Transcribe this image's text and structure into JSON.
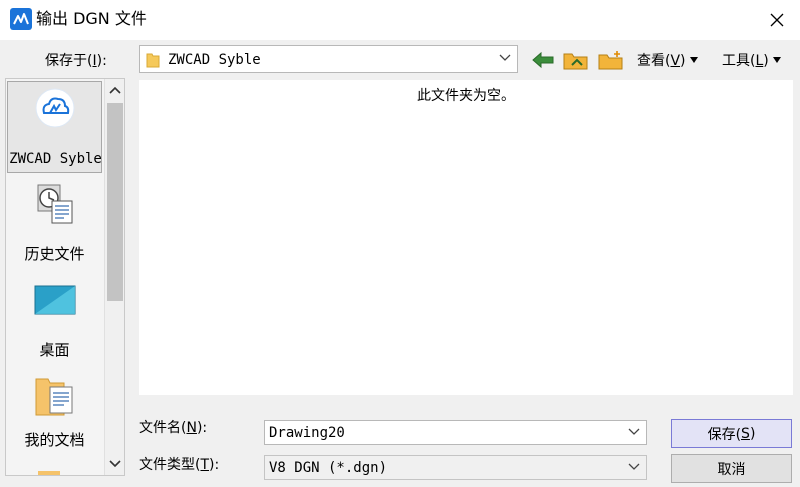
{
  "window": {
    "title": "输出 DGN 文件"
  },
  "toolbar": {
    "save_in_label_prefix": "保存于(",
    "save_in_label_key": "I",
    "save_in_label_suffix": "):",
    "path": "ZWCAD Syble",
    "view_menu_prefix": "查看(",
    "view_menu_key": "V",
    "view_menu_suffix": ")",
    "tools_menu_prefix": "工具(",
    "tools_menu_key": "L",
    "tools_menu_suffix": ")"
  },
  "places": [
    {
      "label": "ZWCAD Syble",
      "icon": "cloud-drive-icon"
    },
    {
      "label": "历史文件",
      "icon": "history-icon"
    },
    {
      "label": "桌面",
      "icon": "desktop-icon"
    },
    {
      "label": "我的文档",
      "icon": "documents-icon"
    }
  ],
  "filelist": {
    "empty_message": "此文件夹为空。"
  },
  "filename": {
    "label_prefix": "文件名(",
    "label_key": "N",
    "label_suffix": "):",
    "value": "Drawing20"
  },
  "filetype": {
    "label_prefix": "文件类型(",
    "label_key": "T",
    "label_suffix": "):",
    "value": "V8 DGN (*.dgn)"
  },
  "buttons": {
    "save_prefix": "保存(",
    "save_key": "S",
    "save_suffix": ")",
    "cancel": "取消"
  },
  "colors": {
    "accent": "#1a73d9",
    "primary_button_border": "#7a7ad6"
  }
}
